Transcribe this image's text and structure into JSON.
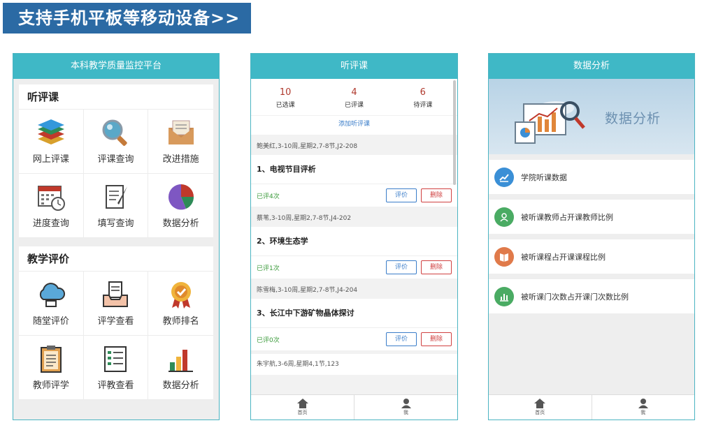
{
  "banner": {
    "text": "支持手机平板等移动设备>>"
  },
  "phone1": {
    "header": "本科教学质量监控平台",
    "section1": {
      "title": "听评课",
      "items": [
        {
          "label": "网上评课",
          "icon": "layers-icon"
        },
        {
          "label": "评课查询",
          "icon": "magnifier-icon"
        },
        {
          "label": "改进措施",
          "icon": "envelope-icon"
        },
        {
          "label": "进度查询",
          "icon": "calendar-clock-icon"
        },
        {
          "label": "填写查询",
          "icon": "scroll-quill-icon"
        },
        {
          "label": "数据分析",
          "icon": "pie-chart-icon"
        }
      ]
    },
    "section2": {
      "title": "教学评价",
      "items": [
        {
          "label": "随堂评价",
          "icon": "cloud-icon"
        },
        {
          "label": "评学查看",
          "icon": "inbox-doc-icon"
        },
        {
          "label": "教师排名",
          "icon": "award-badge-icon"
        },
        {
          "label": "教师评学",
          "icon": "clipboard-icon"
        },
        {
          "label": "评教查看",
          "icon": "checklist-icon"
        },
        {
          "label": "数据分析",
          "icon": "bar-chart-icon"
        }
      ]
    }
  },
  "phone2": {
    "header": "听评课",
    "stats": [
      {
        "num": "10",
        "label": "已选课"
      },
      {
        "num": "4",
        "label": "已评课"
      },
      {
        "num": "6",
        "label": "待评课"
      }
    ],
    "add_link": "添加听评课",
    "rate_label": "评价",
    "delete_label": "删除",
    "courses": [
      {
        "meta": "鲍美红,3-10周,星期2,7-8节,J2-208",
        "title": "1、电视节目评析",
        "rated": "已评4次"
      },
      {
        "meta": "蔡苇,3-10周,星期2,7-8节,J4-202",
        "title": "2、环境生态学",
        "rated": "已评1次"
      },
      {
        "meta": "陈雪梅,3-10周,星期2,7-8节,J4-204",
        "title": "3、长江中下游矿物晶体探讨",
        "rated": "已评0次"
      }
    ],
    "last_meta": "朱宇航,3-6周,星期4,1节,123",
    "tabs": [
      {
        "label": "首页"
      },
      {
        "label": "我"
      }
    ]
  },
  "phone3": {
    "header": "数据分析",
    "hero_text": "数据分析",
    "items": [
      {
        "label": "学院听课数据",
        "color": "#3a8fd6"
      },
      {
        "label": "被听课教师占开课教师比例",
        "color": "#4aab63"
      },
      {
        "label": "被听课程占开课课程比例",
        "color": "#e07a4a"
      },
      {
        "label": "被听课门次数占开课门次数比例",
        "color": "#4aab63"
      }
    ],
    "tabs": [
      {
        "label": "首页"
      },
      {
        "label": "我"
      }
    ]
  }
}
